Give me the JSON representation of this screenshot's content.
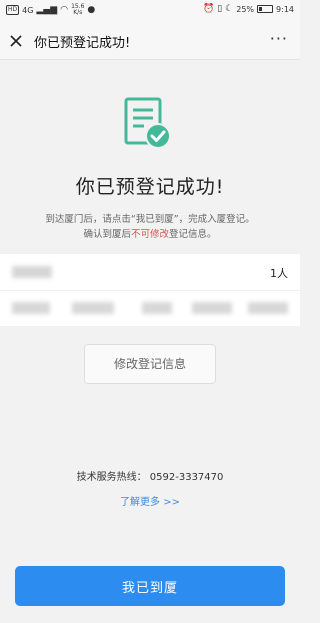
{
  "status_bar": {
    "hd": "HD",
    "signal": "4G",
    "speed_value": "15.6",
    "speed_unit": "K/s",
    "battery": "25%",
    "time": "9:14"
  },
  "nav": {
    "title": "你已预登记成功!",
    "more": "···"
  },
  "main": {
    "title": "你已预登记成功!",
    "hint_line1": "到达厦门后，请点击“我已到厦”，完成入厦登记。",
    "hint_line2_before": "确认到厦后",
    "hint_line2_red": "不可修改",
    "hint_line2_after": "登记信息。"
  },
  "registration": {
    "visitor_count": "1人"
  },
  "buttons": {
    "edit": "修改登记信息",
    "arrive": "我已到厦"
  },
  "footer": {
    "support": "技术服务热线： 0592-3337470",
    "learn_more": "了解更多 >>"
  },
  "colors": {
    "accent": "#2d8cf0",
    "success_icon": "#44b99a",
    "warning_text": "#d9534f",
    "link": "#3d8be0"
  }
}
